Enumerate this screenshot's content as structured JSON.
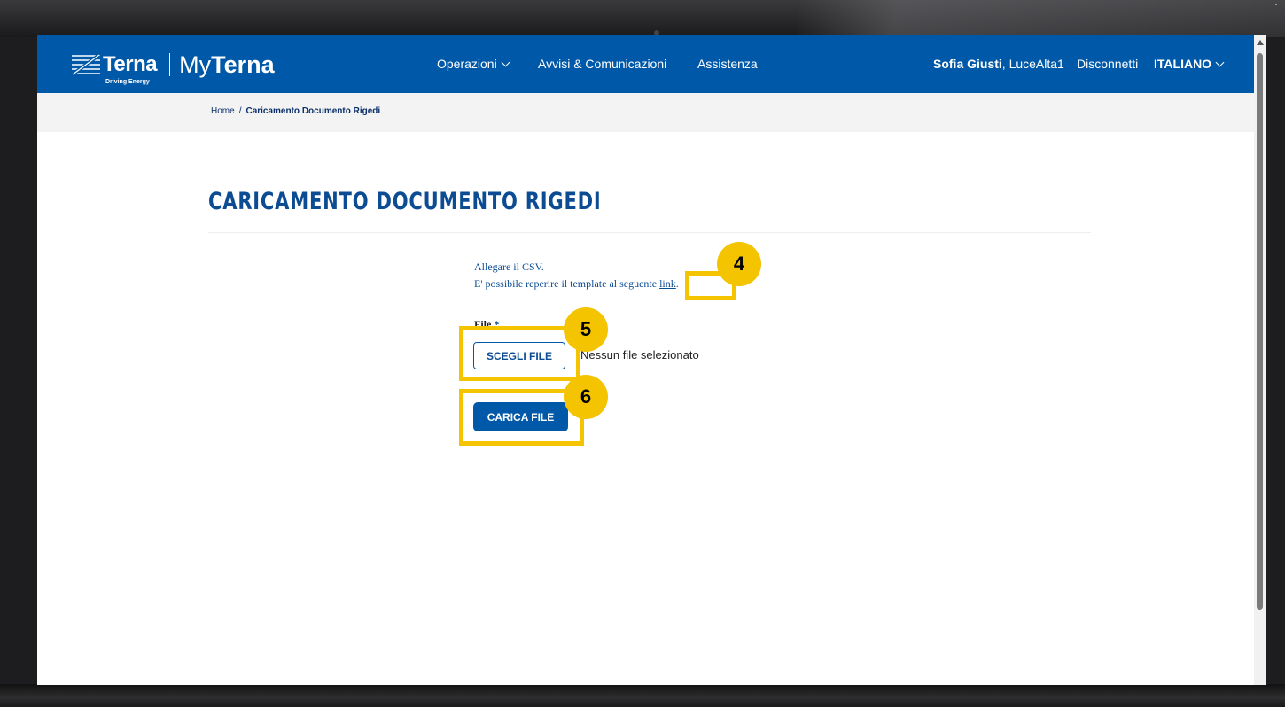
{
  "brand": {
    "terna": "Terna",
    "tagline": "Driving Energy",
    "my_prefix": "My",
    "my_name": "Terna"
  },
  "nav": {
    "operazioni": "Operazioni",
    "avvisi": "Avvisi & Comunicazioni",
    "assistenza": "Assistenza",
    "user_name": "Sofia Giusti",
    "user_account": ", LuceAlta1",
    "logout": "Disconnetti",
    "language": "ITALIANO"
  },
  "breadcrumb": {
    "home": "Home",
    "separator": "/",
    "current": "Caricamento Documento Rigedi"
  },
  "page": {
    "title": "CARICAMENTO DOCUMENTO RIGEDI",
    "info_line1": "Allegare il CSV.",
    "info_line2": "E' possibile reperire il template al seguente ",
    "link_text": "link",
    "link_suffix": ".",
    "file_label": "File",
    "required_mark": " *",
    "choose_button": "SCEGLI FILE",
    "no_file": "Nessun file selezionato",
    "upload_button": "CARICA FILE"
  },
  "annotations": {
    "step4": "4",
    "step5": "5",
    "step6": "6",
    "color": "#f5c400"
  },
  "colors": {
    "header": "#0058a8",
    "title": "#0b4c93"
  }
}
